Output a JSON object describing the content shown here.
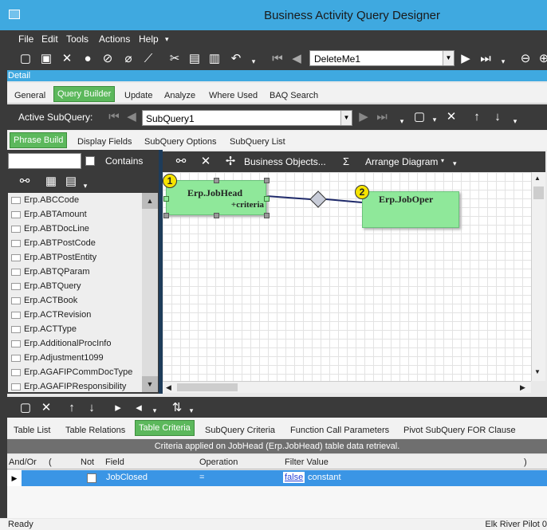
{
  "window": {
    "title": "Business Activity Query Designer"
  },
  "menu": [
    "File",
    "Edit",
    "Tools",
    "Actions",
    "Help"
  ],
  "toolbar": {
    "query_id": "DeleteMe1"
  },
  "section_label": "Detail",
  "main_tabs": [
    "General",
    "Query Builder",
    "Update",
    "Analyze",
    "Where Used",
    "BAQ Search"
  ],
  "subquery": {
    "label": "Active SubQuery:",
    "value": "SubQuery1"
  },
  "sub_tabs": [
    "Phrase Build",
    "Display Fields",
    "SubQuery Options",
    "SubQuery List"
  ],
  "search": {
    "contains_label": "Contains"
  },
  "tables": [
    "Erp.ABCCode",
    "Erp.ABTAmount",
    "Erp.ABTDocLine",
    "Erp.ABTPostCode",
    "Erp.ABTPostEntity",
    "Erp.ABTQParam",
    "Erp.ABTQuery",
    "Erp.ACTBook",
    "Erp.ACTRevision",
    "Erp.ACTType",
    "Erp.AdditionalProcInfo",
    "Erp.Adjustment1099",
    "Erp.AGAFIPCommDocType",
    "Erp.AGAFIPResponsibility"
  ],
  "canvas_toolbar": {
    "business_objects": "Business Objects...",
    "sigma": "Σ",
    "arrange": "Arrange Diagram"
  },
  "diagram": {
    "table1": {
      "number": "1",
      "name": "Erp.JobHead",
      "note": "+criteria"
    },
    "table2": {
      "number": "2",
      "name": "Erp.JobOper"
    }
  },
  "bottom_tabs": [
    "Table List",
    "Table Relations",
    "Table Criteria",
    "SubQuery Criteria",
    "Function Call Parameters",
    "Pivot SubQuery FOR Clause"
  ],
  "criteria_banner": "Criteria applied on JobHead (Erp.JobHead)  table data retrieval.",
  "grid": {
    "headers": [
      "And/Or",
      "(",
      "Not",
      "Field",
      "Operation",
      "Filter Value",
      ")"
    ],
    "row": {
      "field": "JobClosed",
      "operation": "=",
      "value_link": "false",
      "value_text": "constant"
    }
  },
  "status": {
    "left": "Ready",
    "right": "Elk River Pilot 0"
  },
  "colors": {
    "accent": "#3fa9e0",
    "active_tab": "#5cb85c",
    "table_box": "#8fe89a",
    "selected_row": "#3a95e5"
  }
}
